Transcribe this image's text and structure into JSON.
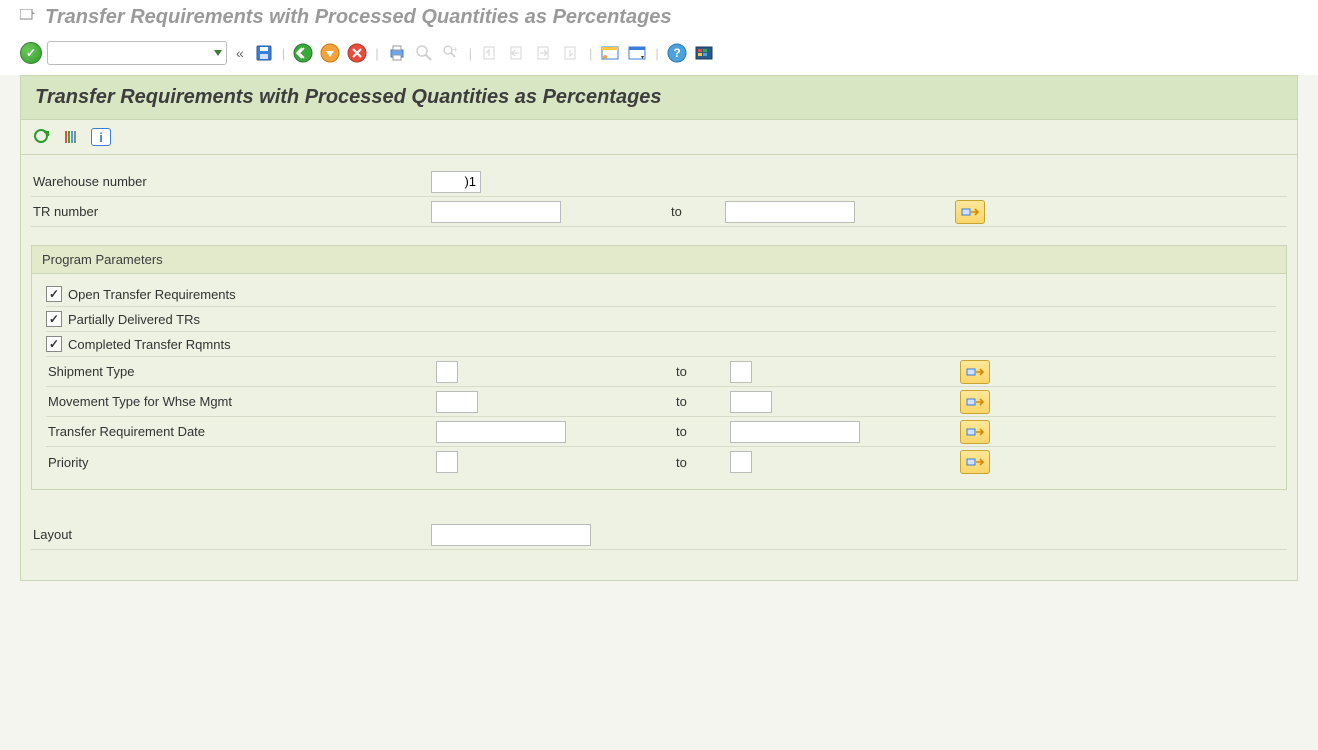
{
  "window": {
    "title": "Transfer Requirements with Processed Quantities as Percentages"
  },
  "page": {
    "title": "Transfer Requirements with Processed Quantities as Percentages"
  },
  "toolbar": {
    "icons": {
      "accept": "accept-icon",
      "save": "save-icon",
      "back": "back-icon",
      "exit": "exit-icon",
      "cancel": "cancel-icon",
      "print": "print-icon",
      "find": "find-icon",
      "find_next": "find-next-icon",
      "first_page": "first-page-icon",
      "prev_page": "prev-page-icon",
      "next_page": "next-page-icon",
      "last_page": "last-page-icon",
      "new_session": "new-session-icon",
      "layout": "layout-icon",
      "help": "help-icon",
      "customize": "customize-icon"
    }
  },
  "subtoolbar": {
    "execute": "execute-icon",
    "get_variant": "get-variant-icon",
    "info": "info-icon"
  },
  "selection": {
    "warehouse_number": {
      "label": "Warehouse number",
      "value": ")1"
    },
    "tr_number": {
      "label": "TR number",
      "from": "",
      "to_label": "to",
      "to": ""
    }
  },
  "group": {
    "title": "Program Parameters",
    "checkboxes": {
      "open_tr": {
        "label": "Open Transfer Requirements",
        "checked": true
      },
      "partial_tr": {
        "label": "Partially Delivered TRs",
        "checked": true
      },
      "completed_tr": {
        "label": "Completed Transfer Rqmnts",
        "checked": true
      }
    },
    "ranges": {
      "shipment_type": {
        "label": "Shipment Type",
        "from": "",
        "to_label": "to",
        "to": ""
      },
      "movement_type": {
        "label": "Movement Type for Whse Mgmt",
        "from": "",
        "to_label": "to",
        "to": ""
      },
      "tr_date": {
        "label": "Transfer Requirement Date",
        "from": "",
        "to_label": "to",
        "to": ""
      },
      "priority": {
        "label": "Priority",
        "from": "",
        "to_label": "to",
        "to": ""
      }
    }
  },
  "layout": {
    "label": "Layout",
    "value": ""
  }
}
